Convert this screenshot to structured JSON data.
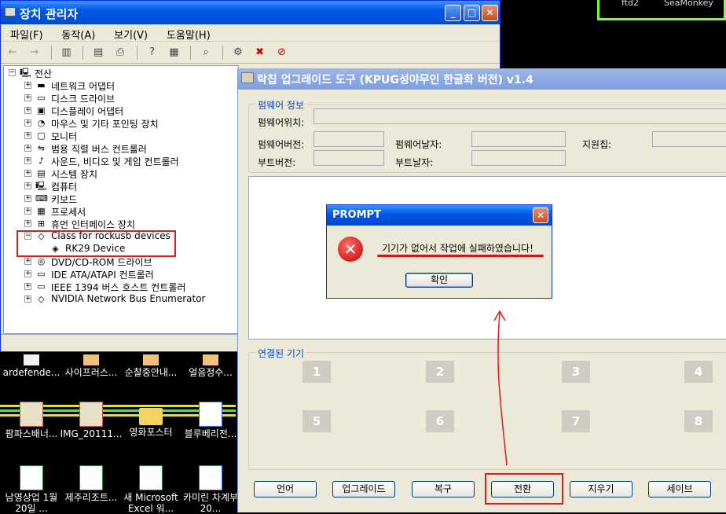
{
  "bg_window": {
    "left_text": "ftd2",
    "right_text": "SeaMonkey"
  },
  "device_manager": {
    "title": "장치 관리자",
    "menu": [
      "파일(F)",
      "동작(A)",
      "보기(V)",
      "도움말(H)"
    ],
    "tree_root": "전산",
    "tree_items": [
      {
        "label": "네트워크 어댑터",
        "icon": "network-icon"
      },
      {
        "label": "디스크 드라이브",
        "icon": "disk-icon"
      },
      {
        "label": "디스플레이 어댑터",
        "icon": "display-icon"
      },
      {
        "label": "마우스 및 기타 포인팅 장치",
        "icon": "mouse-icon"
      },
      {
        "label": "모니터",
        "icon": "monitor-icon"
      },
      {
        "label": "범용 직렬 버스 컨트롤러",
        "icon": "usb-icon"
      },
      {
        "label": "사운드, 비디오 및 게임 컨트롤러",
        "icon": "sound-icon"
      },
      {
        "label": "시스템 장치",
        "icon": "system-icon"
      },
      {
        "label": "컴퓨터",
        "icon": "computer-icon"
      },
      {
        "label": "키보드",
        "icon": "keyboard-icon"
      },
      {
        "label": "프로세서",
        "icon": "processor-icon"
      },
      {
        "label": "휴먼 인터페이스 장치",
        "icon": "hid-icon"
      },
      {
        "label": "Class for rockusb devices",
        "icon": "rockusb-icon"
      },
      {
        "label": "RK29 Device",
        "icon": "device-icon"
      },
      {
        "label": "DVD/CD-ROM 드라이브",
        "icon": "cdrom-icon"
      },
      {
        "label": "IDE ATA/ATAPI 컨트롤러",
        "icon": "ide-icon"
      },
      {
        "label": "IEEE 1394 버스 호스트 컨트롤러",
        "icon": "ieee1394-icon"
      },
      {
        "label": "NVIDIA Network Bus Enumerator",
        "icon": "nvidia-icon"
      }
    ]
  },
  "desktop_icons": [
    {
      "label": "ardefende..."
    },
    {
      "label": "사이프러스..."
    },
    {
      "label": "순찰중안내..."
    },
    {
      "label": "얼음정수..."
    },
    {
      "label": "팜파스배너..."
    },
    {
      "label": "IMG_20111..."
    },
    {
      "label": "영화포스터"
    },
    {
      "label": "블루베리전..."
    },
    {
      "label": "남영상업 1월 20일 ..."
    },
    {
      "label": "제주리조트..."
    },
    {
      "label": "새 Microsoft Excel 워..."
    },
    {
      "label": "카미린 차계부20..."
    }
  ],
  "upgrader": {
    "title": "락칩 업그레이드 도구 (KPUG성야무인 한글화 버전) v1.4",
    "firmware_group": "펌웨어 정보",
    "labels": {
      "fw_location": "펌웨어위치:",
      "fw_version": "펌웨어버전:",
      "fw_date": "펌웨어날자:",
      "support_chip": "지원칩:",
      "boot_version": "부트버전:",
      "boot_date": "부트날자:"
    },
    "connected_group": "연결된 기기",
    "slots": [
      "1",
      "2",
      "3",
      "4",
      "5",
      "6",
      "7",
      "8"
    ],
    "buttons": [
      "언어",
      "업그레이드",
      "복구",
      "전환",
      "지우기",
      "세이브"
    ]
  },
  "prompt": {
    "title": "PROMPT",
    "message": "기기가 없어서 작업에 실패하였습니다!",
    "ok": "확인"
  }
}
